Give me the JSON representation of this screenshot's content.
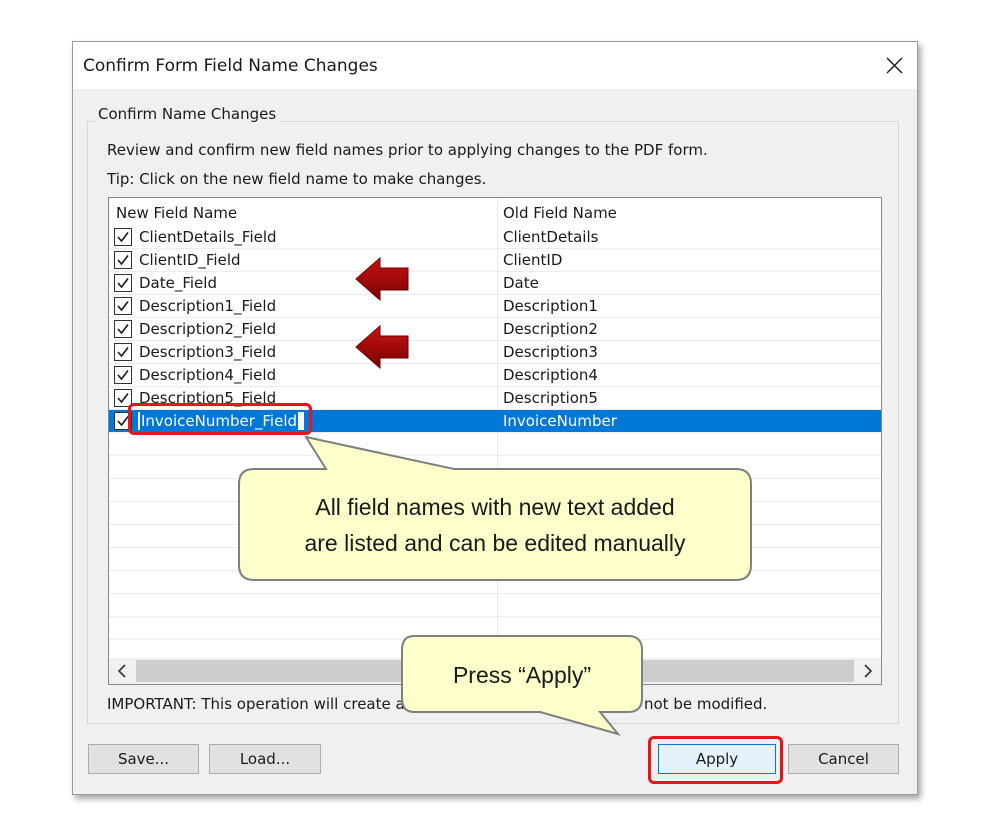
{
  "dialog": {
    "title": "Confirm Form Field Name Changes",
    "group_label": "Confirm Name Changes",
    "description": "Review and confirm new field names prior to applying changes to the PDF form.",
    "tip": "Tip: Click on the new field name to make changes.",
    "important_start": "IMPORTANT: This operation will create a",
    "important_end": "not be modified."
  },
  "table": {
    "columns": [
      "New Field Name",
      "Old Field Name"
    ],
    "rows": [
      {
        "checked": true,
        "new": "ClientDetails_Field",
        "old": "ClientDetails"
      },
      {
        "checked": true,
        "new": "ClientID_Field",
        "old": "ClientID"
      },
      {
        "checked": true,
        "new": "Date_Field",
        "old": "Date"
      },
      {
        "checked": true,
        "new": "Description1_Field",
        "old": "Description1"
      },
      {
        "checked": true,
        "new": "Description2_Field",
        "old": "Description2"
      },
      {
        "checked": true,
        "new": "Description3_Field",
        "old": "Description3"
      },
      {
        "checked": true,
        "new": "Description4_Field",
        "old": "Description4"
      },
      {
        "checked": true,
        "new": "Description5_Field",
        "old": "Description5"
      },
      {
        "checked": true,
        "new": "InvoiceNumber_Field",
        "old": "InvoiceNumber",
        "selected": true,
        "editing": true
      }
    ]
  },
  "buttons": {
    "save": "Save...",
    "load": "Load...",
    "apply": "Apply",
    "cancel": "Cancel"
  },
  "callouts": {
    "main_line1": "All field names with new text added",
    "main_line2": "are listed and can be edited manually",
    "apply": "Press “Apply”"
  },
  "colors": {
    "selection": "#0078d7",
    "highlight": "#e8141c",
    "arrow": "#a00000",
    "callout_fill": "#ffffcc"
  }
}
